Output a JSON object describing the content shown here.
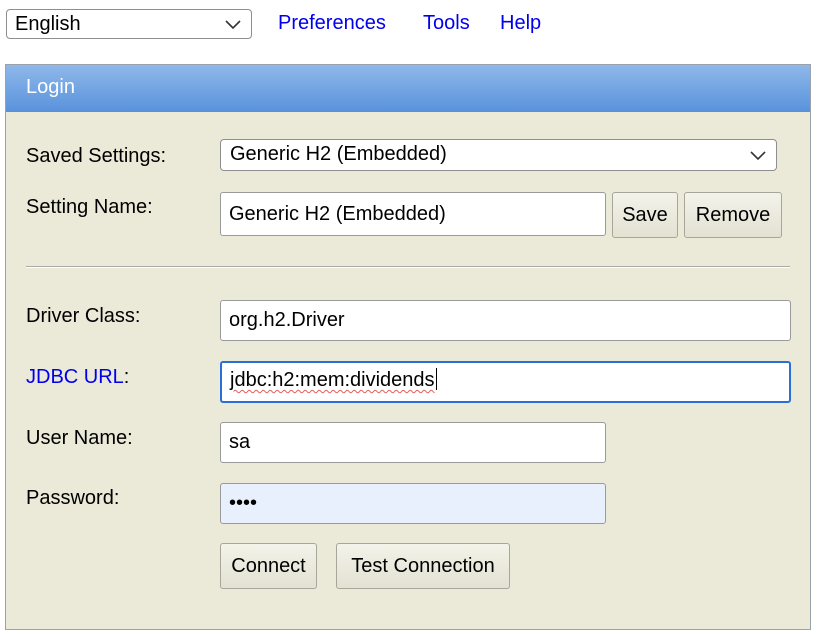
{
  "topbar": {
    "language": "English",
    "links": [
      "Preferences",
      "Tools",
      "Help"
    ]
  },
  "login": {
    "title": "Login",
    "saved_settings_label": "Saved Settings:",
    "saved_settings_value": "Generic H2 (Embedded)",
    "setting_name_label": "Setting Name:",
    "setting_name_value": "Generic H2 (Embedded)",
    "save_label": "Save",
    "remove_label": "Remove",
    "driver_class_label": "Driver Class:",
    "driver_class_value": "org.h2.Driver",
    "jdbc_url_label": "JDBC URL",
    "jdbc_url_colon": ":",
    "jdbc_url_value": "jdbc:h2:mem:dividends",
    "user_name_label": "User Name:",
    "user_name_value": "sa",
    "password_label": "Password:",
    "password_value": "••••",
    "connect_label": "Connect",
    "test_connection_label": "Test Connection"
  },
  "icons": {
    "dropdown": "chevron-down-icon"
  },
  "colors": {
    "link": "#0000ee",
    "header": "#6a9fe2",
    "panel": "#ebe9d8",
    "focus": "#2a6fd6"
  }
}
